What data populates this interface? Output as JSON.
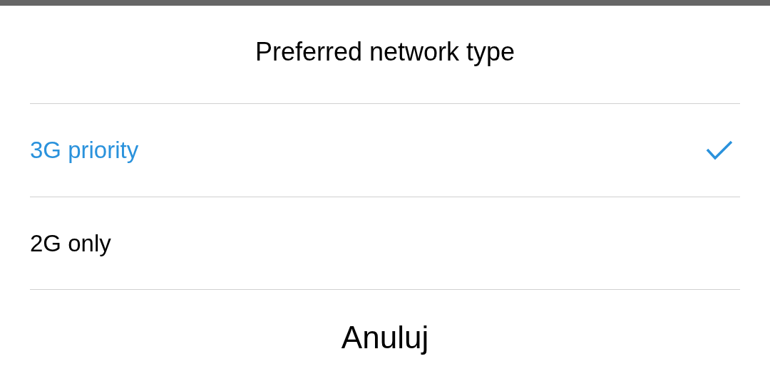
{
  "dialog": {
    "title": "Preferred network type",
    "options": [
      {
        "label": "3G priority",
        "selected": true
      },
      {
        "label": "2G only",
        "selected": false
      }
    ],
    "cancel": "Anuluj"
  }
}
